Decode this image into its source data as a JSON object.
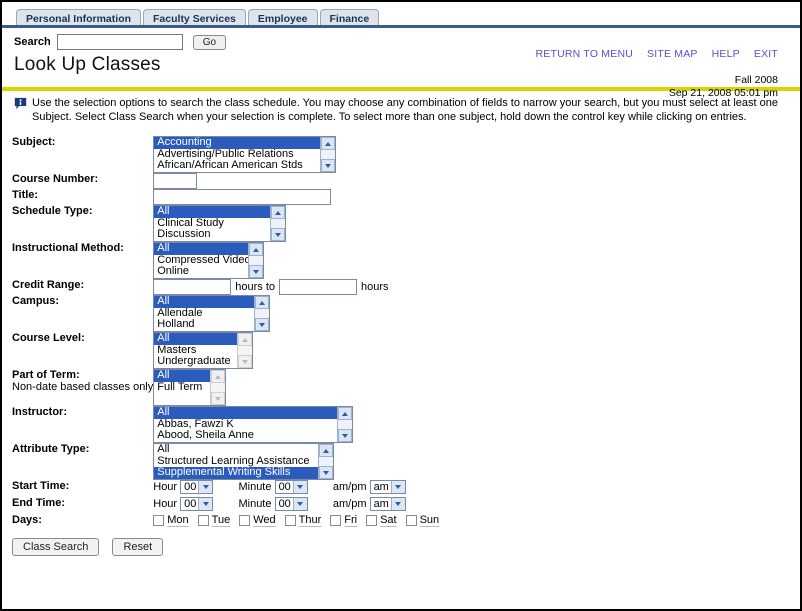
{
  "nav": {
    "tabs": [
      {
        "label": "Personal Information"
      },
      {
        "label": "Faculty Services"
      },
      {
        "label": "Employee"
      },
      {
        "label": "Finance"
      }
    ]
  },
  "search": {
    "label": "Search",
    "value": "",
    "placeholder": "",
    "go_label": "Go"
  },
  "header": {
    "links": [
      {
        "label": "RETURN TO MENU"
      },
      {
        "label": "SITE MAP"
      },
      {
        "label": "HELP"
      },
      {
        "label": "EXIT"
      }
    ],
    "title": "Look Up Classes",
    "term": "Fall 2008",
    "timestamp": "Sep 21, 2008 05:01 pm"
  },
  "info": {
    "icon": "info-bubble-icon",
    "line1": "Use the selection options to search the class schedule. You may choose any combination of fields to narrow your search, but you must select at least one Subject.",
    "line2": "Select Class Search when your selection is complete. To select more than one subject, hold down the control key while clicking on entries."
  },
  "form": {
    "subject": {
      "label": "Subject:",
      "options": [
        "Accounting",
        "Advertising/Public Relations",
        "African/African American Stds"
      ],
      "selected_index": 0
    },
    "course_number": {
      "label": "Course Number:",
      "value": "",
      "placeholder": ""
    },
    "title": {
      "label": "Title:",
      "value": "",
      "placeholder": ""
    },
    "schedule_type": {
      "label": "Schedule Type:",
      "options": [
        "All",
        "Clinical Study",
        "Discussion"
      ],
      "selected_index": 0
    },
    "instructional_method": {
      "label": "Instructional Method:",
      "options": [
        "All",
        "Compressed Video",
        "Online"
      ],
      "selected_index": 0
    },
    "credit_range": {
      "label": "Credit Range:",
      "from_value": "",
      "to_value": "",
      "unit_mid": "hours to",
      "unit_end": "hours"
    },
    "campus": {
      "label": "Campus:",
      "options": [
        "All",
        "Allendale",
        "Holland"
      ],
      "selected_index": 0
    },
    "course_level": {
      "label": "Course Level:",
      "options": [
        "All",
        "Masters",
        "Undergraduate"
      ],
      "selected_index": 0,
      "scroll_enabled": false
    },
    "part_of_term": {
      "label": "Part of Term:",
      "sublabel": "Non-date based classes only",
      "options": [
        "All",
        "Full Term"
      ],
      "selected_index": 0,
      "scroll_enabled": false
    },
    "instructor": {
      "label": "Instructor:",
      "options": [
        "All",
        "Abbas, Fawzi K",
        "Abood, Sheila Anne"
      ],
      "selected_index": 0
    },
    "attribute_type": {
      "label": "Attribute Type:",
      "options": [
        "All",
        "Structured Learning Assistance",
        "Supplemental Writing Skills"
      ],
      "selected_index": 2
    },
    "start_time": {
      "label": "Start Time:",
      "hour_label": "Hour",
      "hour_value": "00",
      "minute_label": "Minute",
      "minute_value": "00",
      "ampm_label": "am/pm",
      "ampm_value": "am"
    },
    "end_time": {
      "label": "End Time:",
      "hour_label": "Hour",
      "hour_value": "00",
      "minute_label": "Minute",
      "minute_value": "00",
      "ampm_label": "am/pm",
      "ampm_value": "am"
    },
    "days": {
      "label": "Days:",
      "items": [
        {
          "label": "Mon",
          "checked": false
        },
        {
          "label": "Tue",
          "checked": false
        },
        {
          "label": "Wed",
          "checked": false
        },
        {
          "label": "Thur",
          "checked": false
        },
        {
          "label": "Fri",
          "checked": false
        },
        {
          "label": "Sat",
          "checked": false
        },
        {
          "label": "Sun",
          "checked": false
        }
      ]
    }
  },
  "actions": {
    "class_search_label": "Class Search",
    "reset_label": "Reset"
  },
  "colors": {
    "tab_rule": "#3b5b8c",
    "yellow_rule": "#d9d400",
    "link": "#5a4fcf",
    "select_highlight": "#2a5bbd"
  }
}
